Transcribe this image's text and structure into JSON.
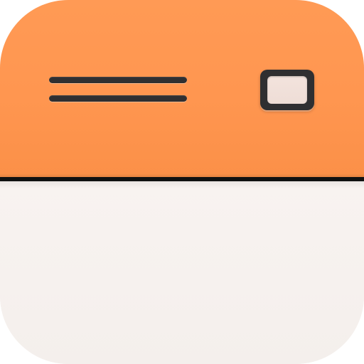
{
  "icon": {
    "top_color": "#FF9A55",
    "divider_color": "#111111",
    "bottom_color": "#F6F1EE",
    "glyphs": [
      "menu-icon",
      "window-icon"
    ]
  }
}
